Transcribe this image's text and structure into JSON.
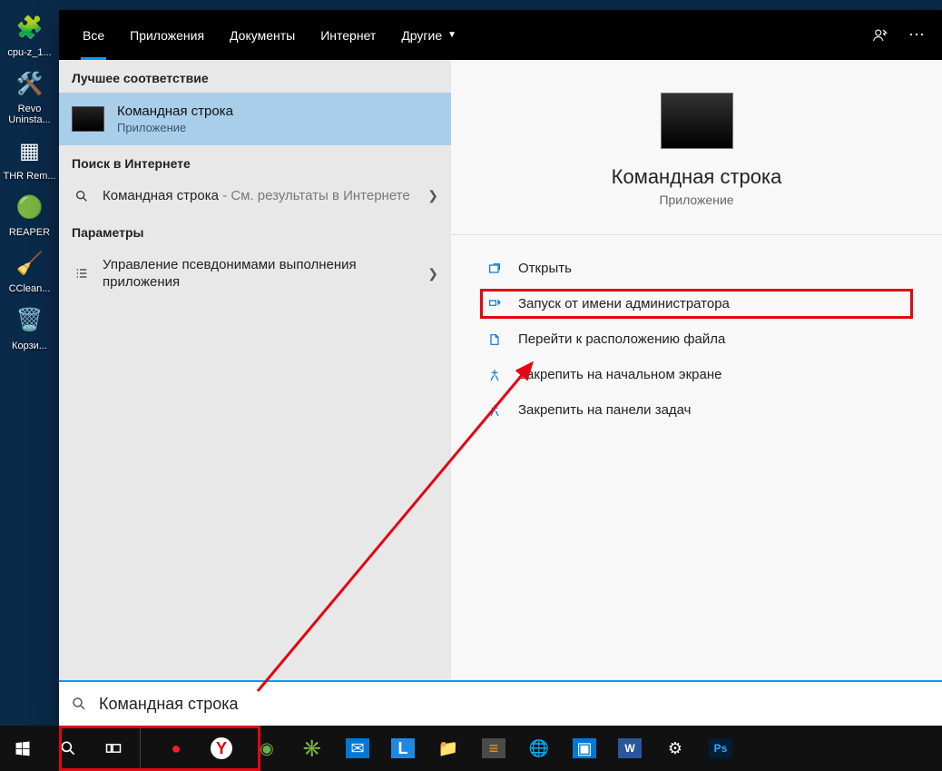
{
  "desktop_icons": [
    {
      "label": "cpu-z_1...",
      "glyph": "🧩"
    },
    {
      "label": "Revo Uninsta...",
      "glyph": "🛠️"
    },
    {
      "label": "THR Rem...",
      "glyph": "▦"
    },
    {
      "label": "REAPER",
      "glyph": "🟢"
    },
    {
      "label": "CClean...",
      "glyph": "🧹"
    },
    {
      "label": "Корзи...",
      "glyph": "🗑️"
    }
  ],
  "tabs": {
    "all": "Все",
    "apps": "Приложения",
    "docs": "Документы",
    "internet": "Интернет",
    "more": "Другие"
  },
  "sections": {
    "best": "Лучшее соответствие",
    "web": "Поиск в Интернете",
    "params": "Параметры"
  },
  "best_match": {
    "title": "Командная строка",
    "subtitle": "Приложение"
  },
  "web_result": {
    "prefix": "Командная строка",
    "tail": " - См. результаты в Интернете"
  },
  "settings_result": "Управление псевдонимами выполнения приложения",
  "hero": {
    "title": "Командная строка",
    "subtitle": "Приложение"
  },
  "actions": {
    "open": "Открыть",
    "run_admin": "Запуск от имени администратора",
    "open_loc": "Перейти к расположению файла",
    "pin_start": "Закрепить на начальном экране",
    "pin_task": "Закрепить на панели задач"
  },
  "search_value": "Командная строка"
}
